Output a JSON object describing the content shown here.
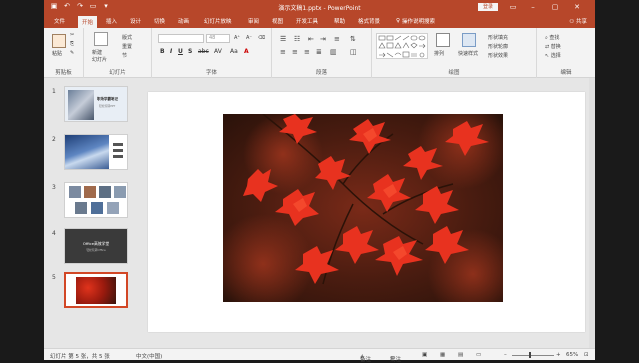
{
  "titlebar": {
    "doc_title": "演示文稿1.pptx  -  PowerPoint",
    "login_label": "登录",
    "qat_icons": [
      "save-icon",
      "undo-icon",
      "redo-icon",
      "start-from-beginning-icon",
      "customize-qat-icon"
    ]
  },
  "tabs": [
    {
      "label": "文件",
      "active": false
    },
    {
      "label": "开始",
      "active": true
    },
    {
      "label": "插入",
      "active": false
    },
    {
      "label": "设计",
      "active": false
    },
    {
      "label": "切换",
      "active": false
    },
    {
      "label": "动画",
      "active": false
    },
    {
      "label": "幻灯片放映",
      "active": false
    },
    {
      "label": "审阅",
      "active": false
    },
    {
      "label": "视图",
      "active": false
    },
    {
      "label": "开发工具",
      "active": false
    },
    {
      "label": "帮助",
      "active": false
    },
    {
      "label": "格式背景",
      "active": false
    }
  ],
  "tell_me": "操作说明搜索",
  "share_label": "共享",
  "ribbon": {
    "clipboard": {
      "label": "剪贴板",
      "paste": "粘贴"
    },
    "slides": {
      "label": "幻灯片",
      "new_slide": "新建\n幻灯片",
      "layout": "版式",
      "reset": "重置",
      "section": "节"
    },
    "font": {
      "label": "字体",
      "font_size": "48",
      "font_name": ""
    },
    "paragraph": {
      "label": "段落"
    },
    "drawing": {
      "label": "绘图",
      "arrange": "排列",
      "quick_styles": "快速样式",
      "shape_fill": "形状填充",
      "shape_outline": "形状轮廓",
      "shape_effects": "形状效果"
    },
    "editing": {
      "label": "编辑",
      "find": "查找",
      "replace": "替换",
      "select": "选择"
    }
  },
  "slides": [
    {
      "num": "1",
      "title_text": "职场学霸笔记",
      "subtitle_text": "轻松玩转PPT"
    },
    {
      "num": "2"
    },
    {
      "num": "3"
    },
    {
      "num": "4",
      "title_text": "Office高效学堂",
      "subtitle_text": "轻松玩转Office"
    },
    {
      "num": "5",
      "selected": true
    }
  ],
  "status": {
    "slide_info": "幻灯片 第 5 张，共 5 张",
    "language": "中文(中国)",
    "notes": "备注",
    "comments": "批注",
    "zoom": "65%"
  },
  "colors": {
    "accent": "#b7472a",
    "selected_border": "#d24726"
  }
}
